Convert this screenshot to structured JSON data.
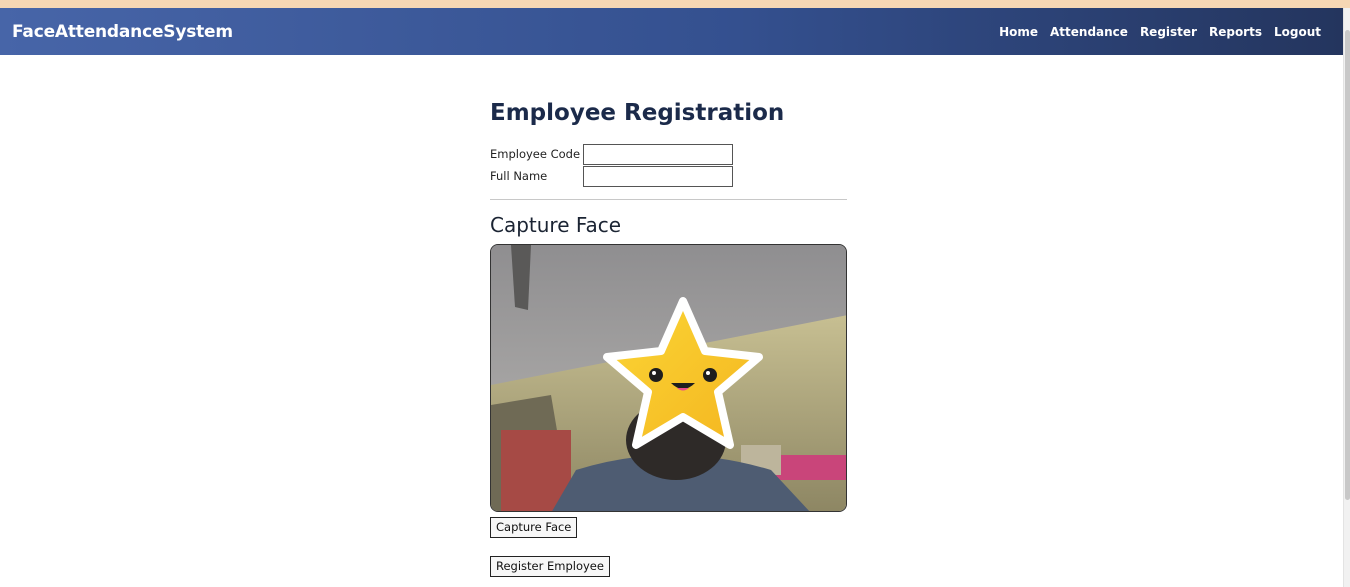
{
  "navbar": {
    "brand": "FaceAttendanceSystem",
    "links": [
      "Home",
      "Attendance",
      "Register",
      "Reports",
      "Logout"
    ]
  },
  "page": {
    "title": "Employee Registration",
    "fields": [
      {
        "label": "Employee Code",
        "value": "",
        "placeholder": ""
      },
      {
        "label": "Full Name",
        "value": "",
        "placeholder": ""
      }
    ],
    "capture_section_title": "Capture Face",
    "capture_button": "Capture Face",
    "register_button": "Register Employee"
  },
  "colors": {
    "navbar_start": "#4765a8",
    "navbar_end": "#24355e",
    "title": "#1b2a4a",
    "star": "#f5c02b"
  },
  "icons": {
    "webcam_overlay": "star-face-icon"
  }
}
